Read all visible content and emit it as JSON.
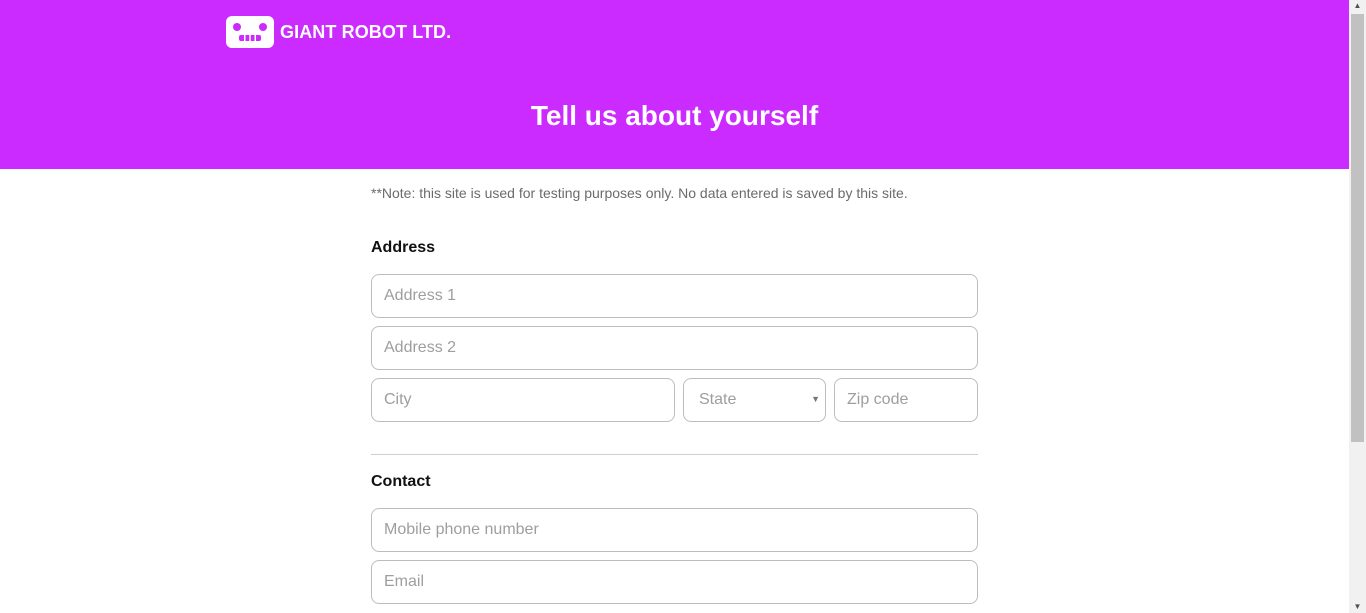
{
  "colors": {
    "brand": "#cc2bff",
    "header_text": "#ffffff",
    "note_text": "#6b6b6b"
  },
  "header": {
    "logo_icon": "robot-face-icon",
    "brand_name": "GIANT ROBOT LTD.",
    "title": "Tell us about yourself"
  },
  "note": "**Note: this site is used for testing purposes only. No data entered is saved by this site.",
  "address": {
    "heading": "Address",
    "address1_placeholder": "Address 1",
    "address2_placeholder": "Address 2",
    "city_placeholder": "City",
    "state_placeholder": "State",
    "zip_placeholder": "Zip code"
  },
  "contact": {
    "heading": "Contact",
    "mobile_placeholder": "Mobile phone number",
    "email_placeholder": "Email"
  },
  "scrollbar": {
    "up_icon": "scroll-up-arrow-icon",
    "down_icon": "scroll-down-arrow-icon"
  }
}
